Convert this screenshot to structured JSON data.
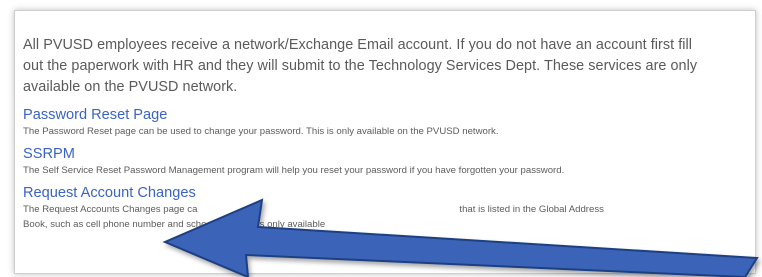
{
  "intro": {
    "line1": "All PVUSD employees receive a network/Exchange Email account.  If you do not have an account first fill",
    "line2": "out the paperwork with HR and they will submit to the Technology Services Dept. These services are only",
    "line3": "available on the PVUSD network."
  },
  "items": [
    {
      "title": "Password Reset Page",
      "description": "The Password Reset page can be used to change your password. This is only available on the PVUSD network."
    },
    {
      "title": "SSRPM",
      "description": "The Self Service Reset Password Management program will help you reset your password if you have forgotten your password."
    },
    {
      "title": "Request Account Changes",
      "description_line1": "The Request Accounts Changes page ca",
      "description_line1_end": "that is listed in the Global Address",
      "description_line2": "Book, such as cell phone number and school site. This is only available"
    }
  ],
  "annotation": {
    "arrow_color": "#3a63b8",
    "arrow_outline": "#1e3f82",
    "icon": "annotation-arrow-icon"
  }
}
